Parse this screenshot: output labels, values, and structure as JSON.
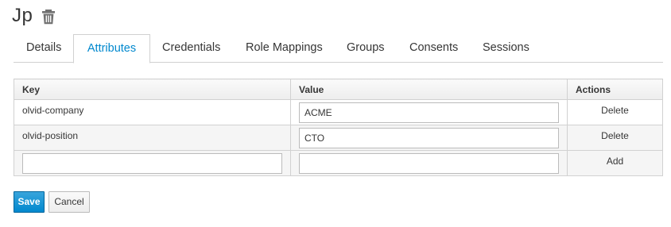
{
  "header": {
    "title": "Jp",
    "delete_icon": "trash-icon"
  },
  "tabs": [
    {
      "label": "Details"
    },
    {
      "label": "Attributes",
      "active": true
    },
    {
      "label": "Credentials"
    },
    {
      "label": "Role Mappings"
    },
    {
      "label": "Groups"
    },
    {
      "label": "Consents"
    },
    {
      "label": "Sessions"
    }
  ],
  "table": {
    "columns": {
      "key": "Key",
      "value": "Value",
      "actions": "Actions"
    },
    "rows": [
      {
        "key": "olvid-company",
        "value": "ACME",
        "action": "Delete"
      },
      {
        "key": "olvid-position",
        "value": "CTO",
        "action": "Delete"
      }
    ],
    "new_row": {
      "key": "",
      "value": "",
      "action": "Add"
    }
  },
  "buttons": {
    "save": "Save",
    "cancel": "Cancel"
  },
  "colors": {
    "accent": "#0088ce",
    "primary_button": "#0088ce",
    "border": "#d1d1d1"
  }
}
